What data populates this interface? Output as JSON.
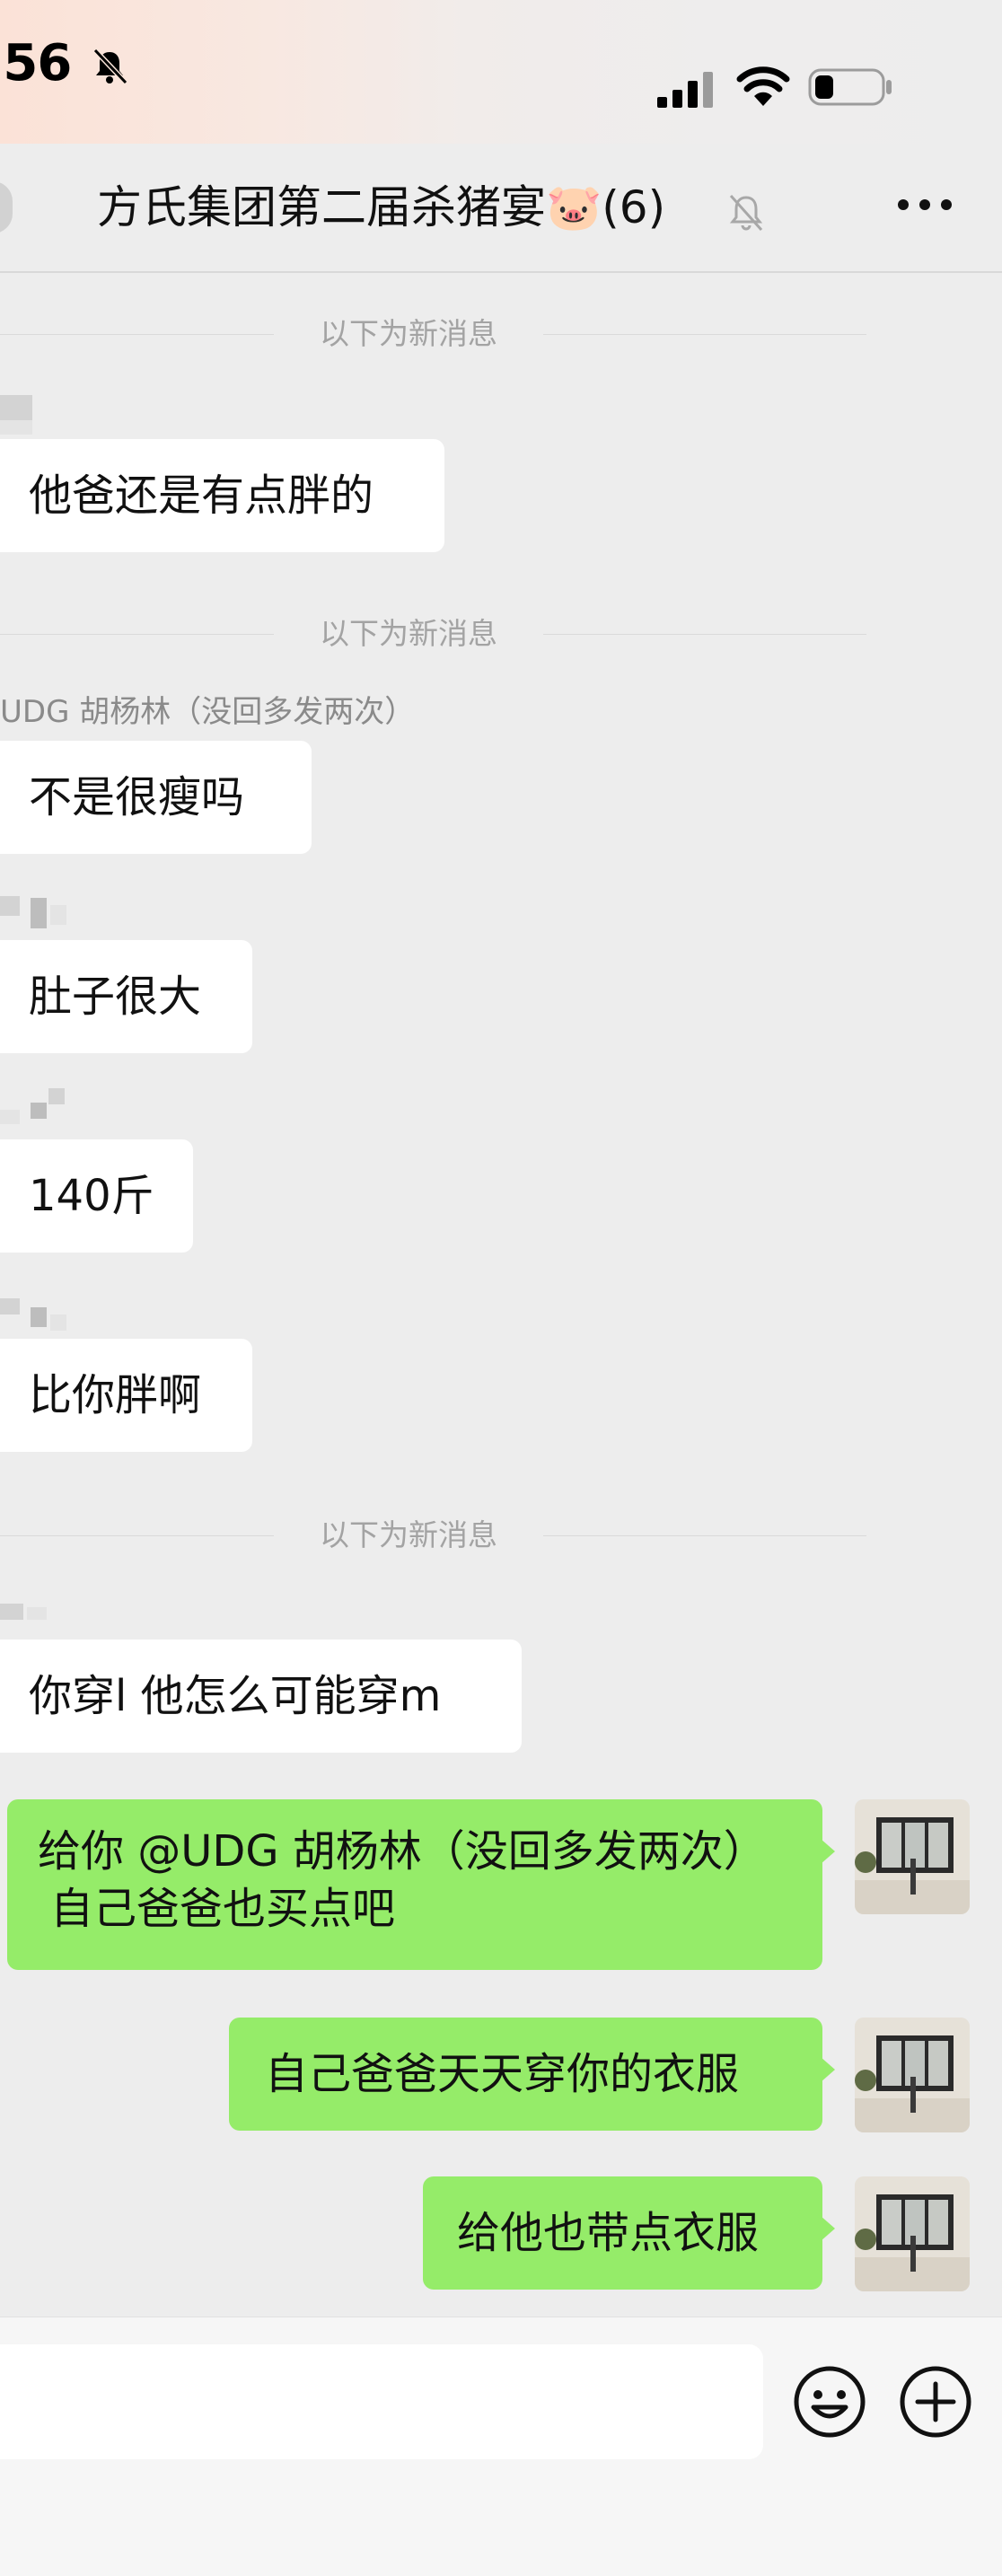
{
  "status_bar": {
    "time": ":56",
    "icons": [
      "bell-off-icon",
      "signal-icon",
      "wifi-icon",
      "battery-icon"
    ]
  },
  "header": {
    "title": "方氏集团第二届杀猪宴🐷(6)",
    "icons": [
      "back-icon",
      "mute-icon",
      "more-icon"
    ]
  },
  "dividers": {
    "d1": "以下为新消息",
    "d2": "以下为新消息",
    "d3": "以下为新消息"
  },
  "messages": {
    "m1": "他爸还是有点胖的",
    "sender_m2": "UDG 胡杨林（没回多发两次）",
    "m2": "不是很瘦吗",
    "m3": "肚子很大",
    "m4": "140斤",
    "m5": "比你胖啊",
    "m6": "你穿l 他怎么可能穿m",
    "r1_line1": "给你 @UDG 胡杨林（没回多发两次）",
    "r1_line2": "自己爸爸也买点吧",
    "r2": "自己爸爸天天穿你的衣服",
    "r3": "给他也带点衣服"
  },
  "input_bar": {
    "icons": [
      "emoji-icon",
      "plus-icon"
    ]
  },
  "colors": {
    "background": "#EDEDED",
    "sent_bubble": "#95EC69",
    "received_bubble": "#FFFFFF",
    "divider_text": "#A3A3A3"
  }
}
